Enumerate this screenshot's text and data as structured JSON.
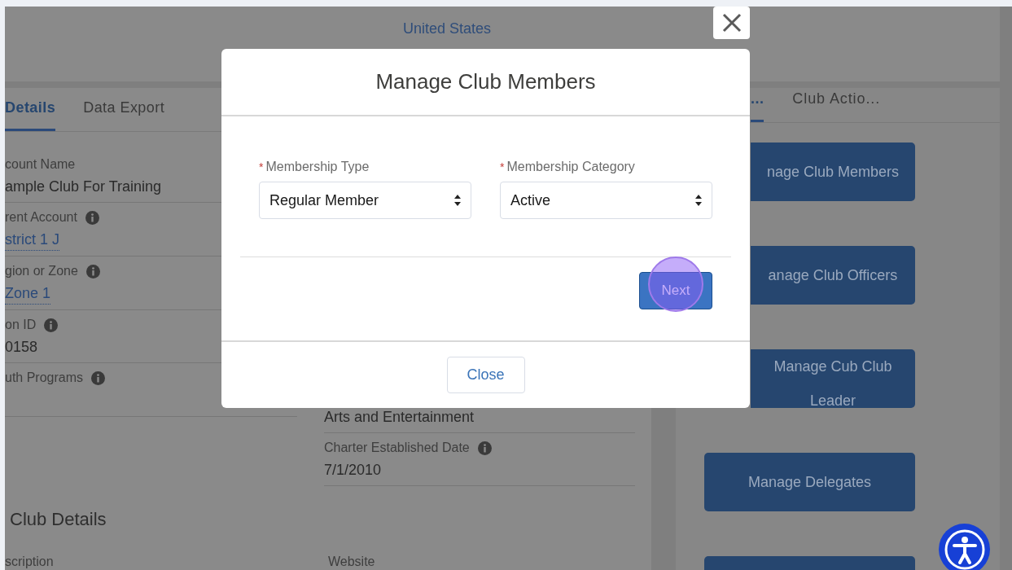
{
  "header": {
    "address": "United States"
  },
  "record_tabs": [
    {
      "label": "Details",
      "selected": true
    },
    {
      "label": "Data Export",
      "selected": false
    }
  ],
  "fields_left": [
    {
      "label": "count Name",
      "kind": "text",
      "value": "ample Club For Training"
    },
    {
      "label": "rent Account",
      "info": true,
      "kind": "link",
      "value": "strict 1 J"
    },
    {
      "label": "gion or Zone",
      "info": true,
      "kind": "link",
      "value": "Zone 1"
    },
    {
      "label": "on ID",
      "info": true,
      "kind": "text",
      "value": "0158"
    },
    {
      "label": "uth Programs",
      "info": true,
      "kind": "empty"
    }
  ],
  "fields_right": [
    {
      "kind": "text",
      "value": "Arts and Entertainment"
    },
    {
      "label": "Charter Established Date",
      "info": true,
      "kind": "text",
      "value": "7/1/2010"
    }
  ],
  "section": {
    "title": "Club Details",
    "fields": [
      "scription",
      "Website"
    ]
  },
  "side_tabs": [
    {
      "label": "...",
      "selected": true
    },
    {
      "label": "Club Actio...",
      "selected": false
    }
  ],
  "action_buttons": [
    {
      "kind": "covered",
      "label": "nage Club Members"
    },
    {
      "kind": "covered",
      "label": "anage Club Officers"
    },
    {
      "kind": "covered",
      "label": "Manage Cub Club Leader"
    },
    {
      "kind": "full",
      "label": "Manage Delegates"
    },
    {
      "kind": "cut"
    }
  ],
  "modal": {
    "title": "Manage Club Members",
    "fields": [
      {
        "required_mark": "*",
        "label": "Membership Type",
        "value": "Regular Member"
      },
      {
        "required_mark": "*",
        "label": "Membership Category",
        "value": "Active"
      }
    ],
    "primary_button": {
      "label": "Next",
      "highlighted": true
    },
    "footer_button": "Close"
  }
}
